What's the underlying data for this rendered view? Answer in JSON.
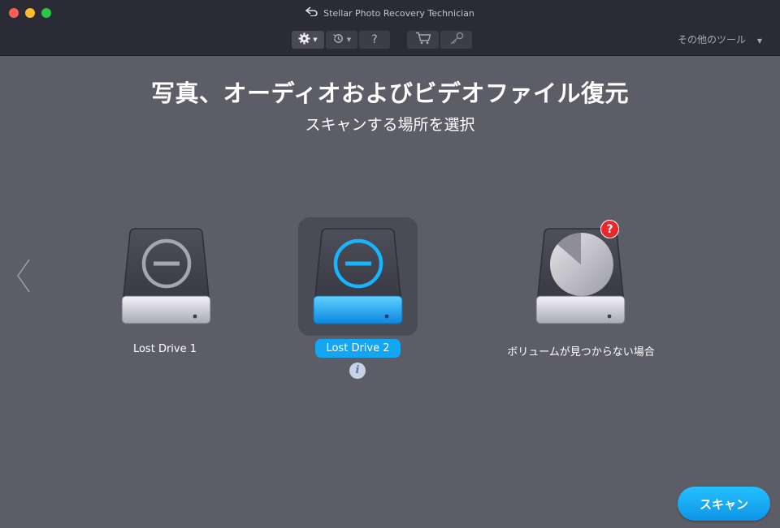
{
  "window": {
    "title": "Stellar Photo Recovery Technician",
    "back_icon": "undo-arrow-icon"
  },
  "toolbar": {
    "buttons": [
      {
        "name": "settings",
        "icon": "gear-icon",
        "has_dropdown": true
      },
      {
        "name": "history",
        "icon": "history-icon",
        "has_dropdown": true
      },
      {
        "name": "help",
        "icon": "question-icon",
        "label": "?"
      },
      {
        "name": "cart",
        "icon": "cart-icon"
      },
      {
        "name": "activate",
        "icon": "key-icon"
      }
    ],
    "other_tools_label": "その他のツール"
  },
  "main": {
    "title": "写真、オーディオおよびビデオファイル復元",
    "subtitle": "スキャンする場所を選択"
  },
  "drives": [
    {
      "label": "Lost Drive 1",
      "selected": false,
      "icon": "lost-drive-icon"
    },
    {
      "label": "Lost Drive 2",
      "selected": true,
      "icon": "lost-drive-icon"
    },
    {
      "label": "ボリュームが見つからない場合",
      "selected": false,
      "icon": "missing-volume-drive-icon",
      "badge": "?"
    }
  ],
  "info_icon": {
    "label": "i"
  },
  "scan_button": {
    "label": "スキャン"
  },
  "colors": {
    "background": "#5d5d67",
    "titlebar": "#2b2b35",
    "accent": "#13a6f2",
    "badge_red": "#e8282b"
  }
}
